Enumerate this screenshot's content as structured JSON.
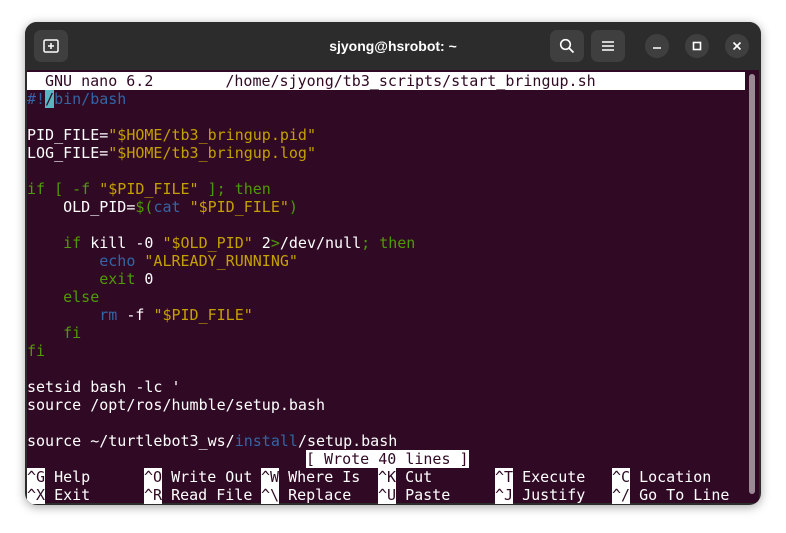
{
  "window": {
    "title": "sjyong@hsrobot: ~"
  },
  "icons": {
    "new_tab": "new-tab-icon",
    "search": "search-icon",
    "menu": "hamburger-menu-icon",
    "minimize": "minimize-icon",
    "maximize": "maximize-icon",
    "close": "close-icon"
  },
  "nano": {
    "version": "GNU nano 6.2",
    "file_path": "/home/sjyong/tb3_scripts/start_bringup.sh",
    "status_message": "[ Wrote 40 lines ]"
  },
  "code": {
    "l1_a": "#!",
    "l1_cursor": "/",
    "l1_b": "bin/bash",
    "l3_a": "PID_FILE=",
    "l3_b": "\"$HOME/tb3_bringup.pid\"",
    "l4_a": "LOG_FILE=",
    "l4_b": "\"$HOME/tb3_bringup.log\"",
    "l6_a": "if [ -f ",
    "l6_b": "\"$PID_FILE\"",
    "l6_c": " ]; then",
    "l7_a": "    OLD_PID=",
    "l7_b": "$(",
    "l7_c": "cat",
    "l7_d": " ",
    "l7_e": "\"$PID_FILE\"",
    "l7_f": ")",
    "l9_a": "    ",
    "l9_b": "if",
    "l9_c": " kill -0 ",
    "l9_d": "\"$OLD_PID\"",
    "l9_e": " 2",
    "l9_f": ">",
    "l9_g": "/dev/null",
    "l9_h": "; then",
    "l10_a": "        ",
    "l10_b": "echo",
    "l10_c": " ",
    "l10_d": "\"ALREADY_RUNNING\"",
    "l11_a": "        ",
    "l11_b": "exit",
    "l11_c": " 0",
    "l12": "    else",
    "l13_a": "        ",
    "l13_b": "rm",
    "l13_c": " -f ",
    "l13_d": "\"$PID_FILE\"",
    "l14": "    fi",
    "l15": "fi",
    "l17": "setsid bash -lc '",
    "l18": "source /opt/ros/humble/setup.bash",
    "l20_a": "source ~/turtlebot3_ws/",
    "l20_b": "install",
    "l20_c": "/setup.bash"
  },
  "shortcuts": [
    {
      "key": "^G",
      "label": "Help"
    },
    {
      "key": "^O",
      "label": "Write Out"
    },
    {
      "key": "^W",
      "label": "Where Is"
    },
    {
      "key": "^K",
      "label": "Cut"
    },
    {
      "key": "^T",
      "label": "Execute"
    },
    {
      "key": "^C",
      "label": "Location"
    },
    {
      "key": "^X",
      "label": "Exit"
    },
    {
      "key": "^R",
      "label": "Read File"
    },
    {
      "key": "^\\",
      "label": "Replace"
    },
    {
      "key": "^U",
      "label": "Paste"
    },
    {
      "key": "^J",
      "label": "Justify"
    },
    {
      "key": "^/",
      "label": "Go To Line"
    }
  ],
  "colors": {
    "terminal_bg": "#300a24",
    "string": "#c4a000",
    "keyword": "#4e9a06",
    "builtin": "#3465a4",
    "cursor": "#56b6c2"
  }
}
